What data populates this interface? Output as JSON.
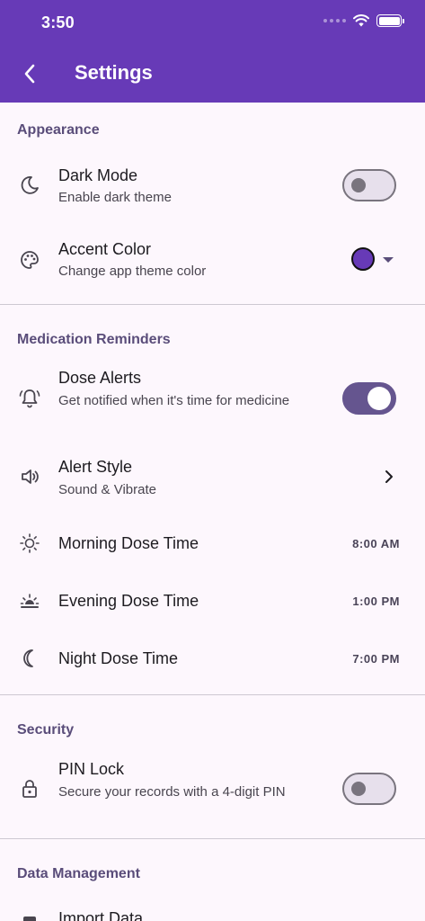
{
  "status_bar": {
    "time": "3:50"
  },
  "app_bar": {
    "title": "Settings"
  },
  "colors": {
    "primary": "#673ab7",
    "toggle_on": "#65558f",
    "accent_swatch": "#673ab7",
    "section_header": "#5a4d7a"
  },
  "sections": {
    "appearance": {
      "header": "Appearance",
      "dark_mode": {
        "title": "Dark Mode",
        "subtitle": "Enable dark theme",
        "icon": "moon-icon",
        "enabled": false
      },
      "accent_color": {
        "title": "Accent Color",
        "subtitle": "Change app theme color",
        "icon": "palette-icon",
        "value": "#673ab7"
      }
    },
    "reminders": {
      "header": "Medication Reminders",
      "dose_alerts": {
        "title": "Dose Alerts",
        "subtitle": "Get notified when it's time for medicine",
        "icon": "bell-icon",
        "enabled": true
      },
      "alert_style": {
        "title": "Alert Style",
        "subtitle": "Sound & Vibrate",
        "icon": "speaker-icon"
      },
      "morning": {
        "title": "Morning Dose Time",
        "value": "8:00 AM",
        "icon": "sun-icon"
      },
      "evening": {
        "title": "Evening Dose Time",
        "value": "1:00 PM",
        "icon": "sunset-icon"
      },
      "night": {
        "title": "Night Dose Time",
        "value": "7:00 PM",
        "icon": "crescent-icon"
      }
    },
    "security": {
      "header": "Security",
      "pin_lock": {
        "title": "PIN Lock",
        "subtitle": "Secure your records with a 4-digit PIN",
        "icon": "lock-icon",
        "enabled": false
      }
    },
    "data_management": {
      "header": "Data Management",
      "import": {
        "title": "Import Data",
        "icon": "import-icon"
      }
    }
  }
}
